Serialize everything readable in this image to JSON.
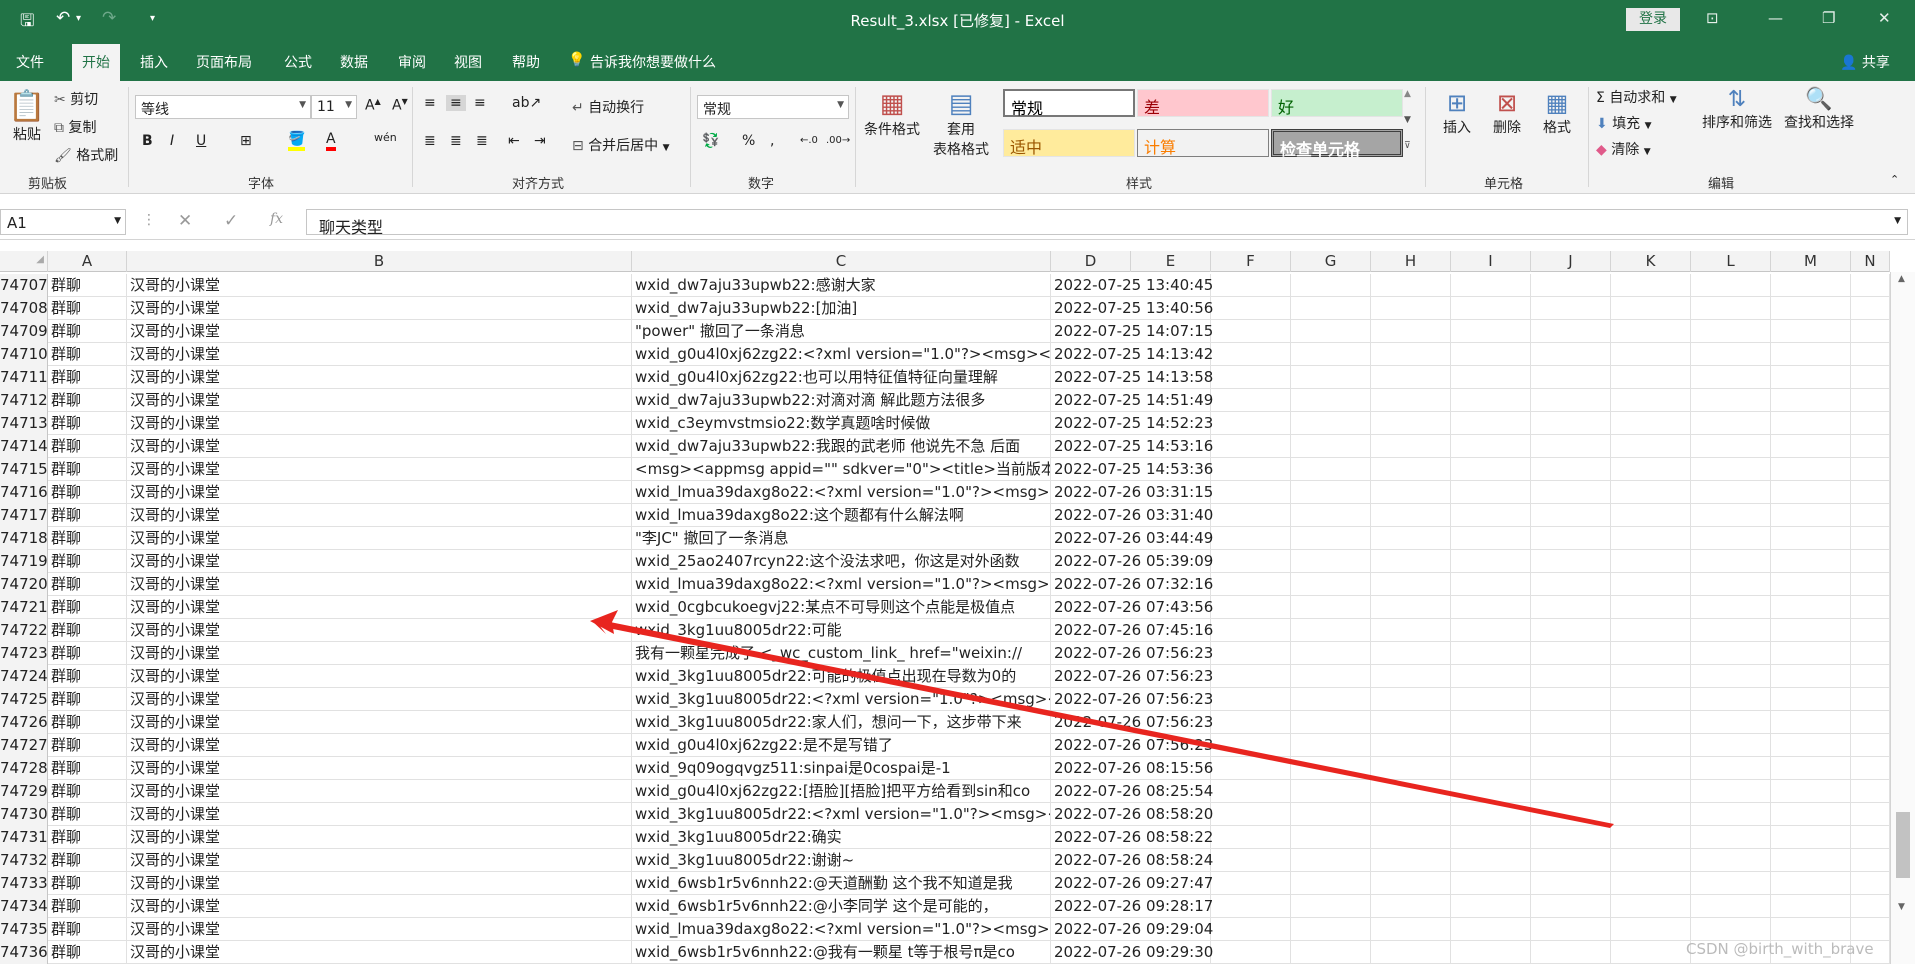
{
  "window": {
    "title": "Result_3.xlsx [已修复] - Excel",
    "login": "登录"
  },
  "menu": [
    "文件",
    "开始",
    "插入",
    "页面布局",
    "公式",
    "数据",
    "审阅",
    "视图",
    "帮助"
  ],
  "tellme": "告诉我你想要做什么",
  "share": "共享",
  "ribbon": {
    "clipboard": {
      "paste": "粘贴",
      "cut": "剪切",
      "copy": "复制",
      "painter": "格式刷",
      "label": "剪贴板"
    },
    "font": {
      "name": "等线",
      "size": "11",
      "label": "字体"
    },
    "alignment": {
      "wrap": "自动换行",
      "merge": "合并后居中",
      "label": "对齐方式"
    },
    "number": {
      "format": "常规",
      "label": "数字"
    },
    "styles": {
      "cond": "条件格式",
      "table1": "套用",
      "table2": "表格格式",
      "label": "样式",
      "cells": [
        {
          "text": "常规",
          "bg": "#ffffff",
          "fg": "#000000"
        },
        {
          "text": "差",
          "bg": "#ffc7ce",
          "fg": "#9c0006"
        },
        {
          "text": "好",
          "bg": "#c6efce",
          "fg": "#006100"
        },
        {
          "text": "适中",
          "bg": "#ffeb9c",
          "fg": "#9c5700"
        },
        {
          "text": "计算",
          "bg": "#f2f2f2",
          "fg": "#fa7d00"
        },
        {
          "text": "检查单元格",
          "bg": "#a5a5a5",
          "fg": "#ffffff"
        }
      ]
    },
    "cells": {
      "insert": "插入",
      "delete": "删除",
      "format": "格式",
      "label": "单元格"
    },
    "editing": {
      "autosum": "自动求和",
      "fill": "填充",
      "clear": "清除",
      "sort": "排序和筛选",
      "find": "查找和选择",
      "label": "编辑"
    }
  },
  "formulabar": {
    "namebox": "A1",
    "content": "聊天类型"
  },
  "columns": [
    "A",
    "B",
    "C",
    "D",
    "E",
    "F",
    "G",
    "H",
    "I",
    "J",
    "K",
    "L",
    "M",
    "N"
  ],
  "rows": [
    {
      "n": "74707",
      "a": "群聊",
      "b": "汉哥的小课堂",
      "c": "wxid_dw7aju33upwb22:感谢大家",
      "d": "2022-07-25 13:40:45"
    },
    {
      "n": "74708",
      "a": "群聊",
      "b": "汉哥的小课堂",
      "c": "wxid_dw7aju33upwb22:[加油]",
      "d": "2022-07-25 13:40:56"
    },
    {
      "n": "74709",
      "a": "群聊",
      "b": "汉哥的小课堂",
      "c": "\"power\" 撤回了一条消息",
      "d": "2022-07-25 14:07:15"
    },
    {
      "n": "74710",
      "a": "群聊",
      "b": "汉哥的小课堂",
      "c": "wxid_g0u4l0xj62zg22:<?xml version=\"1.0\"?><msg><im",
      "d": "2022-07-25 14:13:42"
    },
    {
      "n": "74711",
      "a": "群聊",
      "b": "汉哥的小课堂",
      "c": "wxid_g0u4l0xj62zg22:也可以用特征值特征向量理解",
      "d": "2022-07-25 14:13:58"
    },
    {
      "n": "74712",
      "a": "群聊",
      "b": "汉哥的小课堂",
      "c": "wxid_dw7aju33upwb22:对滴对滴 解此题方法很多",
      "d": "2022-07-25 14:51:49"
    },
    {
      "n": "74713",
      "a": "群聊",
      "b": "汉哥的小课堂",
      "c": "wxid_c3eymvstmsio22:数学真题啥时候做",
      "d": "2022-07-25 14:52:23"
    },
    {
      "n": "74714",
      "a": "群聊",
      "b": "汉哥的小课堂",
      "c": "wxid_dw7aju33upwb22:我跟的武老师 他说先不急 后面",
      "d": "2022-07-25 14:53:16"
    },
    {
      "n": "74715",
      "a": "群聊",
      "b": "汉哥的小课堂",
      "c": "<msg><appmsg appid=\"\" sdkver=\"0\"><title>当前版本",
      "d": "2022-07-25 14:53:36"
    },
    {
      "n": "74716",
      "a": "群聊",
      "b": "汉哥的小课堂",
      "c": "wxid_lmua39daxg8o22:<?xml version=\"1.0\"?><msg><",
      "d": "2022-07-26 03:31:15"
    },
    {
      "n": "74717",
      "a": "群聊",
      "b": "汉哥的小课堂",
      "c": "wxid_lmua39daxg8o22:这个题都有什么解法啊",
      "d": "2022-07-26 03:31:40"
    },
    {
      "n": "74718",
      "a": "群聊",
      "b": "汉哥的小课堂",
      "c": "\"李JC\" 撤回了一条消息",
      "d": "2022-07-26 03:44:49"
    },
    {
      "n": "74719",
      "a": "群聊",
      "b": "汉哥的小课堂",
      "c": "wxid_25ao2407rcyn22:这个没法求吧，你这是对外函数",
      "d": "2022-07-26 05:39:09"
    },
    {
      "n": "74720",
      "a": "群聊",
      "b": "汉哥的小课堂",
      "c": "wxid_lmua39daxg8o22:<?xml version=\"1.0\"?><msg><",
      "d": "2022-07-26 07:32:16"
    },
    {
      "n": "74721",
      "a": "群聊",
      "b": "汉哥的小课堂",
      "c": "wxid_0cgbcukoegvj22:某点不可导则这个点能是极值点",
      "d": "2022-07-26 07:43:56"
    },
    {
      "n": "74722",
      "a": "群聊",
      "b": "汉哥的小课堂",
      "c": "wxid_3kg1uu8005dr22:可能",
      "d": "2022-07-26 07:45:16"
    },
    {
      "n": "74723",
      "a": "群聊",
      "b": "汉哥的小课堂",
      "c": "我有一颗星完成了 <_wc_custom_link_ href=\"weixin://",
      "d": "2022-07-26 07:56:23"
    },
    {
      "n": "74724",
      "a": "群聊",
      "b": "汉哥的小课堂",
      "c": "wxid_3kg1uu8005dr22:可能的极值点出现在导数为0的",
      "d": "2022-07-26 07:56:23"
    },
    {
      "n": "74725",
      "a": "群聊",
      "b": "汉哥的小课堂",
      "c": "wxid_3kg1uu8005dr22:<?xml version=\"1.0\"?><msg><",
      "d": "2022-07-26 07:56:23"
    },
    {
      "n": "74726",
      "a": "群聊",
      "b": "汉哥的小课堂",
      "c": "wxid_3kg1uu8005dr22:家人们，想问一下，这步带下来",
      "d": "2022-07-26 07:56:23"
    },
    {
      "n": "74727",
      "a": "群聊",
      "b": "汉哥的小课堂",
      "c": "wxid_g0u4l0xj62zg22:是不是写错了",
      "d": "2022-07-26 07:56:23"
    },
    {
      "n": "74728",
      "a": "群聊",
      "b": "汉哥的小课堂",
      "c": "wxid_9q09ogqvgz511:sinpai是0cospai是-1",
      "d": "2022-07-26 08:15:56"
    },
    {
      "n": "74729",
      "a": "群聊",
      "b": "汉哥的小课堂",
      "c": "wxid_g0u4l0xj62zg22:[捂脸][捂脸]把平方给看到sin和co",
      "d": "2022-07-26 08:25:54"
    },
    {
      "n": "74730",
      "a": "群聊",
      "b": "汉哥的小课堂",
      "c": "wxid_3kg1uu8005dr22:<?xml version=\"1.0\"?><msg><",
      "d": "2022-07-26 08:58:20"
    },
    {
      "n": "74731",
      "a": "群聊",
      "b": "汉哥的小课堂",
      "c": "wxid_3kg1uu8005dr22:确实",
      "d": "2022-07-26 08:58:22"
    },
    {
      "n": "74732",
      "a": "群聊",
      "b": "汉哥的小课堂",
      "c": "wxid_3kg1uu8005dr22:谢谢~",
      "d": "2022-07-26 08:58:24"
    },
    {
      "n": "74733",
      "a": "群聊",
      "b": "汉哥的小课堂",
      "c": "wxid_6wsb1r5v6nnh22:@天道酬勤  这个我不知道是我",
      "d": "2022-07-26 09:27:47"
    },
    {
      "n": "74734",
      "a": "群聊",
      "b": "汉哥的小课堂",
      "c": "wxid_6wsb1r5v6nnh22:@小李同学  这个是可能的，",
      "d": "2022-07-26 09:28:17"
    },
    {
      "n": "74735",
      "a": "群聊",
      "b": "汉哥的小课堂",
      "c": "wxid_lmua39daxg8o22:<?xml version=\"1.0\"?><msg><",
      "d": "2022-07-26 09:29:04"
    },
    {
      "n": "74736",
      "a": "群聊",
      "b": "汉哥的小课堂",
      "c": "wxid_6wsb1r5v6nnh22:@我有一颗星  t等于根号π是co",
      "d": "2022-07-26 09:29:30"
    }
  ],
  "watermark": "CSDN @birth_with_brave",
  "annotation": {
    "color": "#e8251f"
  }
}
